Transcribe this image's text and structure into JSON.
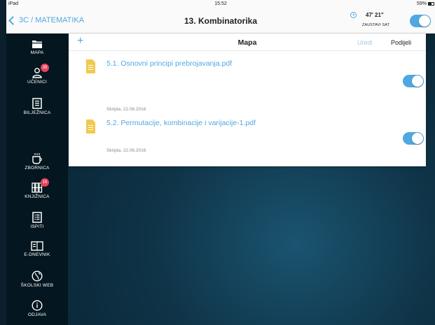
{
  "status_bar": {
    "device": "iPad",
    "time": "15:52",
    "battery": "59%"
  },
  "navbar": {
    "back_label": "3C / MATEMATIKA",
    "title": "13. Kombinatorika",
    "timer_value": "47' 21\"",
    "timer_label": "ZAUSTAVI SAT"
  },
  "sidebar": {
    "items": [
      {
        "label": "MAPA",
        "icon": "folder-icon"
      },
      {
        "label": "UČENICI",
        "icon": "students-icon",
        "badge": "39"
      },
      {
        "label": "BILJEŽNICA",
        "icon": "notebook-icon"
      },
      {
        "label": "ZBORNICA",
        "icon": "coffee-icon"
      },
      {
        "label": "KNJIŽNICA",
        "icon": "library-icon",
        "badge": "16"
      },
      {
        "label": "ISPITI",
        "icon": "exams-icon"
      },
      {
        "label": "E-DNEVNIK",
        "icon": "e-diary-icon"
      },
      {
        "label": "ŠKOLSKI WEB",
        "icon": "globe-icon"
      },
      {
        "label": "ODJAVA",
        "icon": "info-icon"
      }
    ]
  },
  "card": {
    "add_label": "+",
    "title": "Mapa",
    "edit_label": "Uredi",
    "share_label": "Podijeli",
    "files": [
      {
        "name": "5.1. Osnovni principi prebrojavanja.pdf",
        "meta": "Skripta, 22.06.2016",
        "enabled": true
      },
      {
        "name": "5.2. Permutacije, kombinacije i varijacije-1.pdf",
        "meta": "Skripta, 22.06.2016",
        "enabled": true
      }
    ]
  },
  "colors": {
    "accent": "#4fa8e0",
    "sidebar_bg": "#04161f",
    "badge": "#e8425a",
    "file_icon": "#f2c94c"
  }
}
